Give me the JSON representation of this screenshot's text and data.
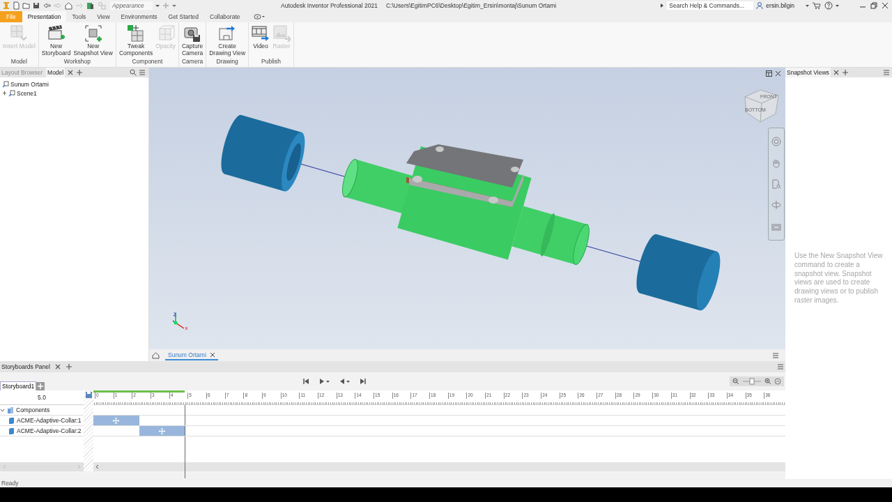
{
  "quick_access": {
    "appearance": "Appearance"
  },
  "window": {
    "title": "Autodesk Inventor Professional 2021",
    "path": "C:\\Users\\EgitimPC6\\Desktop\\Egitim_Ersin\\montaj\\Sunum Ortami"
  },
  "search": {
    "placeholder": "Search Help & Commands..."
  },
  "user": {
    "name": "ersin.bilgin"
  },
  "tabs": [
    {
      "label": "File",
      "kind": "file",
      "selected": false
    },
    {
      "label": "Presentation",
      "kind": "tab",
      "selected": true
    },
    {
      "label": "Tools",
      "kind": "tab",
      "selected": false
    },
    {
      "label": "View",
      "kind": "tab",
      "selected": false
    },
    {
      "label": "Environments",
      "kind": "tab",
      "selected": false
    },
    {
      "label": "Get Started",
      "kind": "tab",
      "selected": false
    },
    {
      "label": "Collaborate",
      "kind": "tab",
      "selected": false
    }
  ],
  "ribbon": [
    {
      "panel": "Model",
      "commands": [
        {
          "lines": [
            "Insert Model"
          ],
          "kind": "insert",
          "disabled": true
        }
      ]
    },
    {
      "panel": "Workshop",
      "commands": [
        {
          "lines": [
            "New",
            "Storyboard"
          ],
          "kind": "storyboard",
          "disabled": false
        },
        {
          "lines": [
            "New",
            "Snapshot View"
          ],
          "kind": "snapshot",
          "disabled": false
        }
      ]
    },
    {
      "panel": "Component",
      "commands": [
        {
          "lines": [
            "Tweak",
            "Components"
          ],
          "kind": "tweak",
          "disabled": false
        },
        {
          "lines": [
            "Opacity"
          ],
          "kind": "opacity",
          "disabled": true
        }
      ]
    },
    {
      "panel": "Camera",
      "commands": [
        {
          "lines": [
            "Capture",
            "Camera"
          ],
          "kind": "camera",
          "disabled": false
        }
      ]
    },
    {
      "panel": "Drawing",
      "commands": [
        {
          "lines": [
            "Create",
            "Drawing View"
          ],
          "kind": "drawing",
          "disabled": false
        }
      ]
    },
    {
      "panel": "Publish",
      "commands": [
        {
          "lines": [
            "Video"
          ],
          "kind": "video",
          "disabled": false
        },
        {
          "lines": [
            "Raster"
          ],
          "kind": "raster",
          "disabled": true
        }
      ]
    }
  ],
  "browser": {
    "tabs": [
      {
        "label": "Layout Browser",
        "selected": false
      },
      {
        "label": "Model",
        "selected": true
      }
    ],
    "tree": [
      {
        "label": "Sunum Ortami"
      },
      {
        "label": "Scene1",
        "expanded": false
      }
    ]
  },
  "viewcube": {
    "faces": [
      "FRONT",
      "BOTTOM"
    ]
  },
  "document_tabs": [
    {
      "label": "Sunum Ortami",
      "selected": true
    }
  ],
  "snapshot_panel": {
    "tab": "Snapshot Views",
    "hint": "Use the New Snapshot View command to create a snapshot view. Snapshot views are used to create drawing views or to publish raster images."
  },
  "storyboards_panel": {
    "title": "Storyboards Panel",
    "tabs": [
      {
        "label": "Storyboard1",
        "selected": true
      }
    ],
    "time": "5.0",
    "playhead": {
      "level": 0.132
    },
    "ruler": [
      "0",
      "1",
      "2",
      "3",
      "4",
      "5",
      "6",
      "7",
      "8",
      "9",
      "10",
      "11",
      "12",
      "13",
      "14",
      "15",
      "16",
      "17",
      "18",
      "19",
      "20",
      "21",
      "22",
      "23",
      "24",
      "25",
      "26",
      "27",
      "28",
      "29",
      "30",
      "31",
      "32",
      "33",
      "34",
      "35",
      "36"
    ],
    "tracks": [
      {
        "label": "Components",
        "kind": "group",
        "expanded": true
      },
      {
        "label": "ACME-Adaptive-Collar:1",
        "kind": "component",
        "clip": {
          "level": 0.066
        }
      },
      {
        "label": "ACME-Adaptive-Collar:2",
        "kind": "component",
        "clip": {
          "level": 0.066
        }
      }
    ]
  },
  "status_bar": {
    "text": "Ready"
  }
}
